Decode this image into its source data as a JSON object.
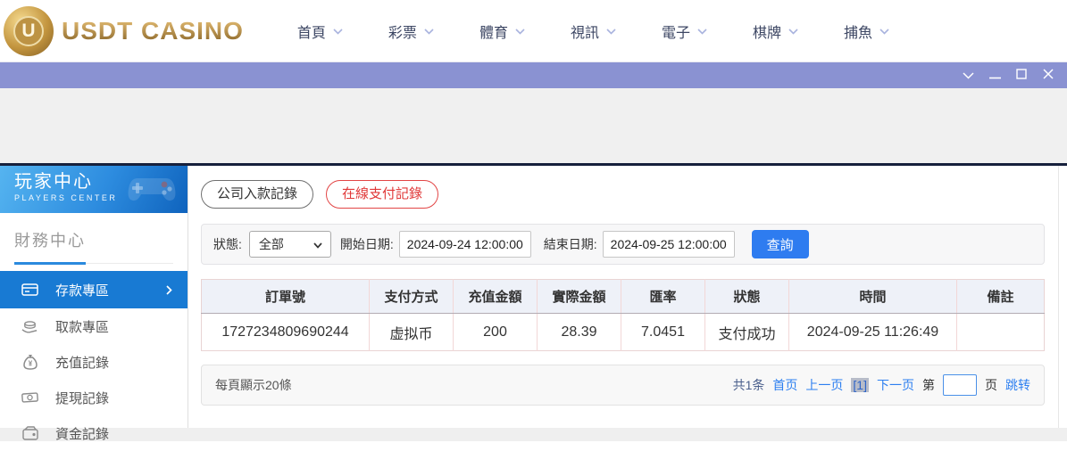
{
  "header": {
    "logo_letter": "U",
    "logo_text": "USDT CASINO",
    "nav_items": [
      {
        "label": "首頁"
      },
      {
        "label": "彩票"
      },
      {
        "label": "體育"
      },
      {
        "label": "視訊"
      },
      {
        "label": "電子"
      },
      {
        "label": "棋牌"
      },
      {
        "label": "捕魚"
      }
    ]
  },
  "sidebar": {
    "title": "玩家中心",
    "subtitle": "PLAYERS CENTER",
    "section_title": "財務中心",
    "items": [
      {
        "label": "存款專區",
        "icon": "card-machine-icon",
        "active": true
      },
      {
        "label": "取款專區",
        "icon": "hand-coin-icon",
        "active": false
      },
      {
        "label": "充值記錄",
        "icon": "money-bag-icon",
        "active": false
      },
      {
        "label": "提現記錄",
        "icon": "banknote-icon",
        "active": false
      },
      {
        "label": "資金記錄",
        "icon": "purse-icon",
        "active": false
      }
    ]
  },
  "main": {
    "tabs": [
      {
        "label": "公司入款記錄",
        "active": false
      },
      {
        "label": "在線支付記錄",
        "active": true
      }
    ],
    "filters": {
      "status_label": "狀態:",
      "status_value": "全部",
      "start_label": "開始日期:",
      "start_value": "2024-09-24 12:00:00",
      "end_label": "結束日期:",
      "end_value": "2024-09-25 12:00:00",
      "search_label": "查詢"
    },
    "table": {
      "headers": [
        "訂單號",
        "支付方式",
        "充值金額",
        "實際金額",
        "匯率",
        "狀態",
        "時間",
        "備註"
      ],
      "rows": [
        [
          "1727234809690244",
          "虚拟币",
          "200",
          "28.39",
          "7.0451",
          "支付成功",
          "2024-09-25 11:26:49",
          ""
        ]
      ]
    },
    "pagination": {
      "page_size_text": "每頁顯示20條",
      "total_text": "共1条",
      "first_label": "首页",
      "prev_label": "上一页",
      "current_label": "[1]",
      "next_label": "下一页",
      "jump_prefix": "第",
      "jump_suffix": "页",
      "jump_action": "跳转"
    }
  },
  "colors": {
    "titlebar_purple": "#8a92d2",
    "sidebar_active_blue": "#187ad3",
    "search_button_blue": "#2e7cf0",
    "tab_active_red": "#e03838",
    "link_blue": "#2d7ff0",
    "logo_gold": "#c9a55a",
    "table_header_bg": "#eef1f8"
  }
}
